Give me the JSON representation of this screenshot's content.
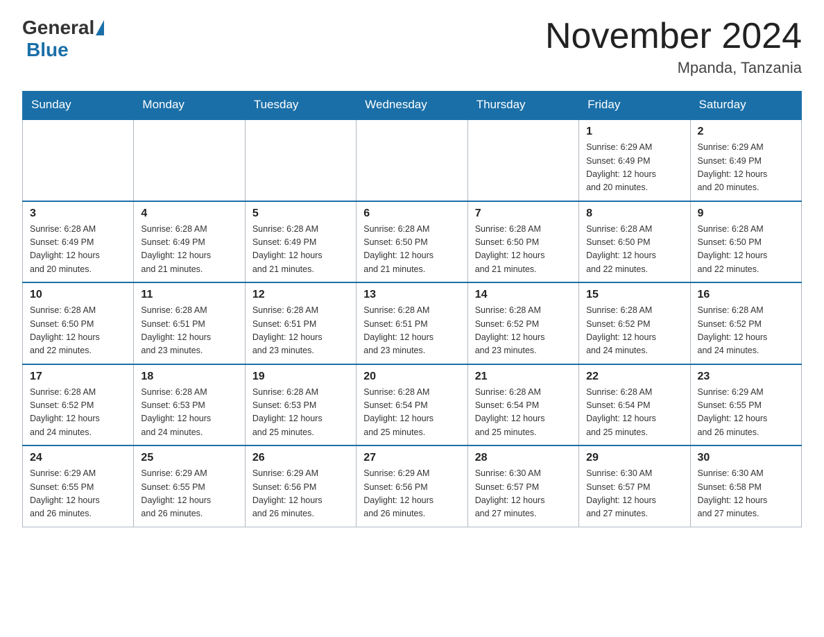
{
  "logo": {
    "general": "General",
    "blue": "Blue"
  },
  "title": "November 2024",
  "location": "Mpanda, Tanzania",
  "weekdays": [
    "Sunday",
    "Monday",
    "Tuesday",
    "Wednesday",
    "Thursday",
    "Friday",
    "Saturday"
  ],
  "weeks": [
    [
      {
        "day": "",
        "info": ""
      },
      {
        "day": "",
        "info": ""
      },
      {
        "day": "",
        "info": ""
      },
      {
        "day": "",
        "info": ""
      },
      {
        "day": "",
        "info": ""
      },
      {
        "day": "1",
        "info": "Sunrise: 6:29 AM\nSunset: 6:49 PM\nDaylight: 12 hours\nand 20 minutes."
      },
      {
        "day": "2",
        "info": "Sunrise: 6:29 AM\nSunset: 6:49 PM\nDaylight: 12 hours\nand 20 minutes."
      }
    ],
    [
      {
        "day": "3",
        "info": "Sunrise: 6:28 AM\nSunset: 6:49 PM\nDaylight: 12 hours\nand 20 minutes."
      },
      {
        "day": "4",
        "info": "Sunrise: 6:28 AM\nSunset: 6:49 PM\nDaylight: 12 hours\nand 21 minutes."
      },
      {
        "day": "5",
        "info": "Sunrise: 6:28 AM\nSunset: 6:49 PM\nDaylight: 12 hours\nand 21 minutes."
      },
      {
        "day": "6",
        "info": "Sunrise: 6:28 AM\nSunset: 6:50 PM\nDaylight: 12 hours\nand 21 minutes."
      },
      {
        "day": "7",
        "info": "Sunrise: 6:28 AM\nSunset: 6:50 PM\nDaylight: 12 hours\nand 21 minutes."
      },
      {
        "day": "8",
        "info": "Sunrise: 6:28 AM\nSunset: 6:50 PM\nDaylight: 12 hours\nand 22 minutes."
      },
      {
        "day": "9",
        "info": "Sunrise: 6:28 AM\nSunset: 6:50 PM\nDaylight: 12 hours\nand 22 minutes."
      }
    ],
    [
      {
        "day": "10",
        "info": "Sunrise: 6:28 AM\nSunset: 6:50 PM\nDaylight: 12 hours\nand 22 minutes."
      },
      {
        "day": "11",
        "info": "Sunrise: 6:28 AM\nSunset: 6:51 PM\nDaylight: 12 hours\nand 23 minutes."
      },
      {
        "day": "12",
        "info": "Sunrise: 6:28 AM\nSunset: 6:51 PM\nDaylight: 12 hours\nand 23 minutes."
      },
      {
        "day": "13",
        "info": "Sunrise: 6:28 AM\nSunset: 6:51 PM\nDaylight: 12 hours\nand 23 minutes."
      },
      {
        "day": "14",
        "info": "Sunrise: 6:28 AM\nSunset: 6:52 PM\nDaylight: 12 hours\nand 23 minutes."
      },
      {
        "day": "15",
        "info": "Sunrise: 6:28 AM\nSunset: 6:52 PM\nDaylight: 12 hours\nand 24 minutes."
      },
      {
        "day": "16",
        "info": "Sunrise: 6:28 AM\nSunset: 6:52 PM\nDaylight: 12 hours\nand 24 minutes."
      }
    ],
    [
      {
        "day": "17",
        "info": "Sunrise: 6:28 AM\nSunset: 6:52 PM\nDaylight: 12 hours\nand 24 minutes."
      },
      {
        "day": "18",
        "info": "Sunrise: 6:28 AM\nSunset: 6:53 PM\nDaylight: 12 hours\nand 24 minutes."
      },
      {
        "day": "19",
        "info": "Sunrise: 6:28 AM\nSunset: 6:53 PM\nDaylight: 12 hours\nand 25 minutes."
      },
      {
        "day": "20",
        "info": "Sunrise: 6:28 AM\nSunset: 6:54 PM\nDaylight: 12 hours\nand 25 minutes."
      },
      {
        "day": "21",
        "info": "Sunrise: 6:28 AM\nSunset: 6:54 PM\nDaylight: 12 hours\nand 25 minutes."
      },
      {
        "day": "22",
        "info": "Sunrise: 6:28 AM\nSunset: 6:54 PM\nDaylight: 12 hours\nand 25 minutes."
      },
      {
        "day": "23",
        "info": "Sunrise: 6:29 AM\nSunset: 6:55 PM\nDaylight: 12 hours\nand 26 minutes."
      }
    ],
    [
      {
        "day": "24",
        "info": "Sunrise: 6:29 AM\nSunset: 6:55 PM\nDaylight: 12 hours\nand 26 minutes."
      },
      {
        "day": "25",
        "info": "Sunrise: 6:29 AM\nSunset: 6:55 PM\nDaylight: 12 hours\nand 26 minutes."
      },
      {
        "day": "26",
        "info": "Sunrise: 6:29 AM\nSunset: 6:56 PM\nDaylight: 12 hours\nand 26 minutes."
      },
      {
        "day": "27",
        "info": "Sunrise: 6:29 AM\nSunset: 6:56 PM\nDaylight: 12 hours\nand 26 minutes."
      },
      {
        "day": "28",
        "info": "Sunrise: 6:30 AM\nSunset: 6:57 PM\nDaylight: 12 hours\nand 27 minutes."
      },
      {
        "day": "29",
        "info": "Sunrise: 6:30 AM\nSunset: 6:57 PM\nDaylight: 12 hours\nand 27 minutes."
      },
      {
        "day": "30",
        "info": "Sunrise: 6:30 AM\nSunset: 6:58 PM\nDaylight: 12 hours\nand 27 minutes."
      }
    ]
  ]
}
